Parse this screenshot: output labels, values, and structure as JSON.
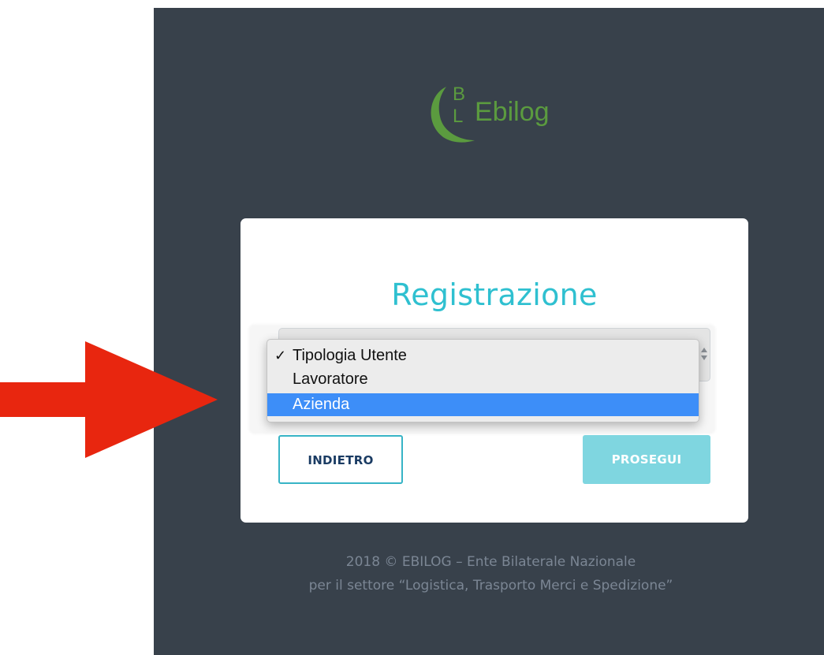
{
  "logo": {
    "letter_top": "B",
    "letter_bottom": "L",
    "word": "Ebilog"
  },
  "card": {
    "title": "Registrazione",
    "select": {
      "options": [
        {
          "label": "Tipologia Utente",
          "checked": true
        },
        {
          "label": "Lavoratore",
          "checked": false
        },
        {
          "label": "Azienda",
          "highlighted": true
        }
      ],
      "check_mark": "✓"
    },
    "back_label": "INDIETRO",
    "next_label": "PROSEGUI"
  },
  "footer": {
    "line1": "2018 © EBILOG – Ente Bilaterale Nazionale",
    "line2": "per il settore “Logistica, Trasporto Merci e Spedizione”"
  },
  "colors": {
    "panel_bg": "#38414b",
    "accent": "#2fc0d0",
    "logo_green": "#5b9b3f",
    "highlight": "#3d8ef8",
    "annotation_arrow": "#e8260f"
  },
  "icons": {
    "annotation": "red-arrow-icon",
    "select_arrows": "up-down-arrows-icon"
  }
}
